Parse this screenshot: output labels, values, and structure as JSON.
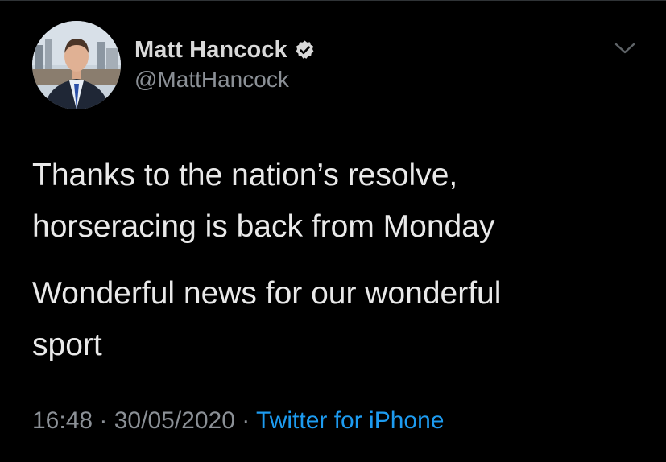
{
  "tweet": {
    "author": {
      "display_name": "Matt Hancock",
      "handle": "@MattHancock",
      "verified": true,
      "avatar_icon": "profile-photo"
    },
    "body": [
      "Thanks to the nation’s resolve,\nhorseracing is back from Monday",
      "Wonderful news for our wonderful\nsport"
    ],
    "time": "16:48",
    "separator": " · ",
    "date": "30/05/2020",
    "source": "Twitter for iPhone",
    "menu_icon": "chevron-down-icon"
  },
  "colors": {
    "background": "#000000",
    "text": "#e9e9e9",
    "secondary_text": "#8b9096",
    "link": "#1d9bf0"
  }
}
